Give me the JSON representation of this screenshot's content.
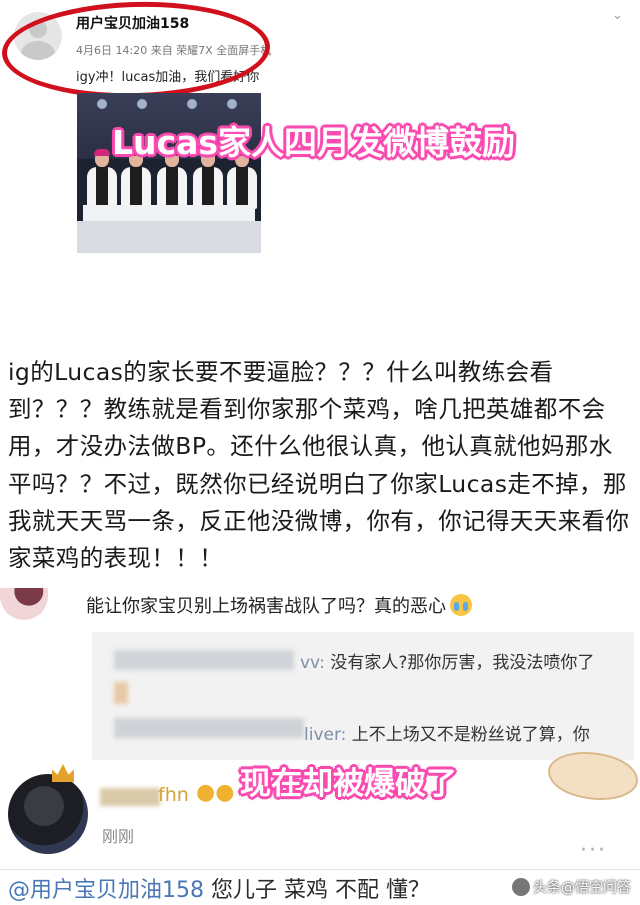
{
  "post": {
    "username": "用户宝贝加油158",
    "meta": "4月6日 14:20 来自 荣耀7X 全面屏手机",
    "text": "igy冲！lucas加油，我们看好你"
  },
  "captions": {
    "top": "Lucas家人四月发微博鼓励",
    "bottom": "现在却被爆破了"
  },
  "long_comment": "ig的Lucas的家长要不要逼脸？？？什么叫教练会看到？？？教练就是看到你家那个菜鸡，啥几把英雄都不会用，才没办法做BP。还什么他很认真，他认真就他妈那水平吗？？不过，既然你已经说明白了你家Lucas走不掉，那我就天天骂一条，反正他没微博，你有，你记得天天来看你家菜鸡的表现！！！",
  "reply_1": {
    "text": "能让你家宝贝别上场祸害战队了吗？真的恶心"
  },
  "reply_box": {
    "line1_name": "vv:",
    "line1_text": " 没有家人?那你厉害，我没法喷你了",
    "line2_name": "liver:",
    "line2_text": " 上不上场又不是粉丝说了算，你"
  },
  "bottom_comment": {
    "name_visible": "fhn",
    "time": "刚刚",
    "mention": "@用户宝贝加油158",
    "text": " 您儿子 菜鸡 不配 懂？"
  },
  "watermark": "头条@悟空问答",
  "colors": {
    "highlight_circle": "#d0101c",
    "caption_glow": "#f54aa9",
    "mention": "#4a78b6"
  }
}
